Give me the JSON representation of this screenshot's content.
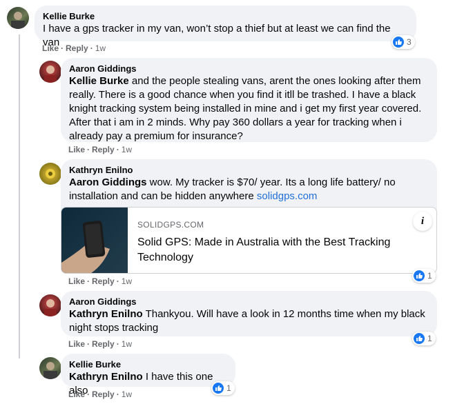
{
  "actions": {
    "like": "Like",
    "reply": "Reply",
    "separator": "·"
  },
  "comments": [
    {
      "author": "Kellie Burke",
      "text": "I have a gps tracker in my van, won’t stop a thief but at least we can find the van",
      "time": "1w",
      "reactions": "3"
    },
    {
      "author": "Aaron Giddings",
      "mention": "Kellie Burke",
      "text": " and the people stealing vans, arent the ones looking after them really. There is a good chance when you find it itll be trashed. I have a black knight tracking system being installed in mine and i get my first year covered. After that i am in 2 minds. Why pay 360 dollars a year for tracking when i already pay a premium for insurance?",
      "time": "1w"
    },
    {
      "author": "Kathryn Enilno",
      "mention": "Aaron Giddings",
      "text": " wow. My tracker is $70/ year. Its a long life battery/ no installation and can be hidden anywhere ",
      "link": "solidgps.com",
      "card": {
        "domain": "SOLIDGPS.COM",
        "title": "Solid GPS: Made in Australia with the Best Tracking Technology"
      },
      "time": "1w",
      "reactions": "1"
    },
    {
      "author": "Aaron Giddings",
      "mention": "Kathryn Enilno",
      "text": " Thankyou. Will have a look in 12 months time when my black night stops tracking",
      "time": "1w",
      "reactions": "1"
    },
    {
      "author": "Kellie Burke",
      "mention": "Kathryn Enilno",
      "text": " I have this one also",
      "time": "1w",
      "reactions": "1"
    }
  ],
  "colors": {
    "bubble": "#f0f2f5",
    "like_blue": "#1877f2",
    "link": "#216fdb",
    "meta_gray": "#65676b"
  },
  "icons": {
    "like": "thumbs-up-icon",
    "info": "info-icon"
  }
}
